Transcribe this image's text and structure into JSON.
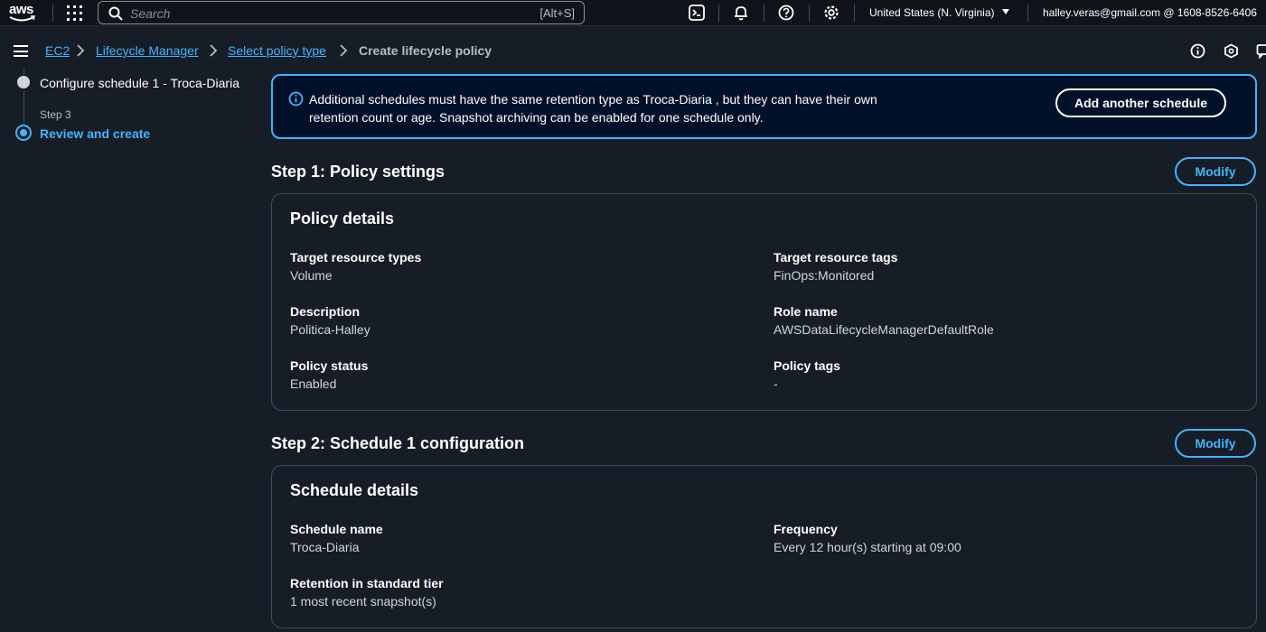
{
  "topnav": {
    "logo_text": "aws",
    "search_placeholder": "Search",
    "search_shortcut": "[Alt+S]",
    "icons": [
      "cloudshell-icon",
      "bell-icon",
      "help-icon",
      "gear-icon"
    ],
    "region": "United States (N. Virginia)",
    "account": "halley.veras@gmail.com @ 1608-8526-6406"
  },
  "breadcrumb": {
    "items": [
      "EC2",
      "Lifecycle Manager",
      "Select policy type"
    ],
    "current": "Create lifecycle policy"
  },
  "wizard": {
    "item2_label": "Configure schedule 1 - Troca-Diaria",
    "step3_label": "Step 3",
    "item3_label": "Review and create"
  },
  "alert": {
    "message": "Additional schedules must have the same retention type as Troca-Diaria , but they can have their own retention count or age. Snapshot archiving can be enabled for one schedule only.",
    "button": "Add another schedule"
  },
  "step1": {
    "title": "Step 1: Policy settings",
    "modify": "Modify",
    "card_title": "Policy details",
    "fields": [
      {
        "key": "Target resource types",
        "value": "Volume"
      },
      {
        "key": "Target resource tags",
        "value": "FinOps:Monitored"
      },
      {
        "key": "Description",
        "value": "Politica-Halley"
      },
      {
        "key": "Role name",
        "value": "AWSDataLifecycleManagerDefaultRole"
      },
      {
        "key": "Policy status",
        "value": "Enabled"
      },
      {
        "key": "Policy tags",
        "value": "-"
      }
    ]
  },
  "step2": {
    "title": "Step 2: Schedule 1 configuration",
    "modify": "Modify",
    "card_title": "Schedule details",
    "fields": [
      {
        "key": "Schedule name",
        "value": "Troca-Diaria"
      },
      {
        "key": "Frequency",
        "value": "Every 12 hour(s) starting at 09:00"
      },
      {
        "key": "Retention in standard tier",
        "value": "1 most recent snapshot(s)"
      }
    ]
  },
  "colors": {
    "background": "#161d26",
    "topbar": "#0f141a",
    "link": "#42b4ff",
    "alert_bg": "#001129",
    "border": "#414d5c"
  }
}
